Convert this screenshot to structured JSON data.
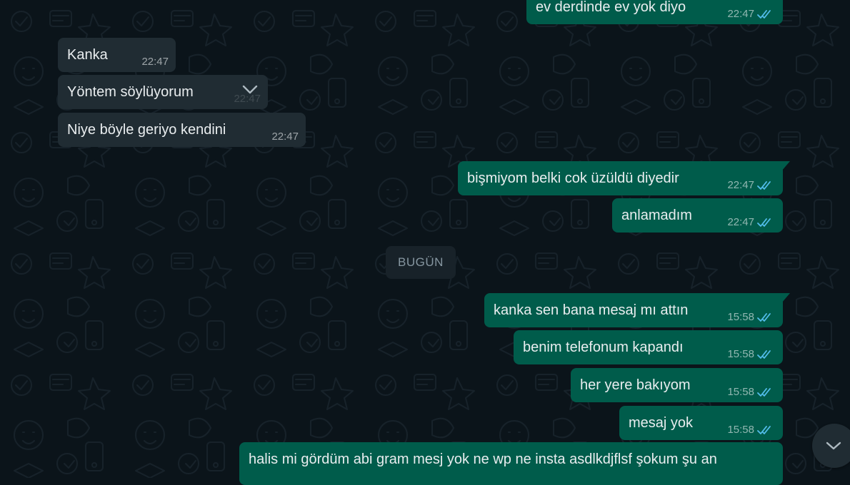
{
  "messages": [
    {
      "dir": "out",
      "text": "ev derdinde ev yok diyo",
      "time": "22:47"
    },
    {
      "dir": "in",
      "text": "Kanka",
      "time": "22:47"
    },
    {
      "dir": "in",
      "text": "Yöntem söylüyorum",
      "time": "22:47"
    },
    {
      "dir": "in",
      "text": "Niye böyle geriyo kendini",
      "time": "22:47"
    },
    {
      "dir": "out",
      "text": "bişmiyom belki cok üzüldü diyedir",
      "time": "22:47"
    },
    {
      "dir": "out",
      "text": "anlamadım",
      "time": "22:47"
    },
    {
      "dir": "out",
      "text": "kanka sen bana mesaj mı attın",
      "time": "15:58"
    },
    {
      "dir": "out",
      "text": "benim telefonum kapandı",
      "time": "15:58"
    },
    {
      "dir": "out",
      "text": "her yere bakıyom",
      "time": "15:58"
    },
    {
      "dir": "out",
      "text": "mesaj yok",
      "time": "15:58"
    },
    {
      "dir": "out",
      "text": "halis mi gördüm abi gram mesj yok ne wp ne insta asdlkdjflsf şokum şu an"
    }
  ],
  "date_separator": "BUGÜN",
  "colors": {
    "background": "#0b141a",
    "incoming_bubble": "#202c33",
    "outgoing_bubble": "#005c4b",
    "text": "#e9edef",
    "read_ticks": "#53bdeb"
  },
  "icons": {
    "read_receipt": "double-check-icon",
    "message_menu": "chevron-down-icon",
    "scroll_down": "chevron-down-icon"
  }
}
